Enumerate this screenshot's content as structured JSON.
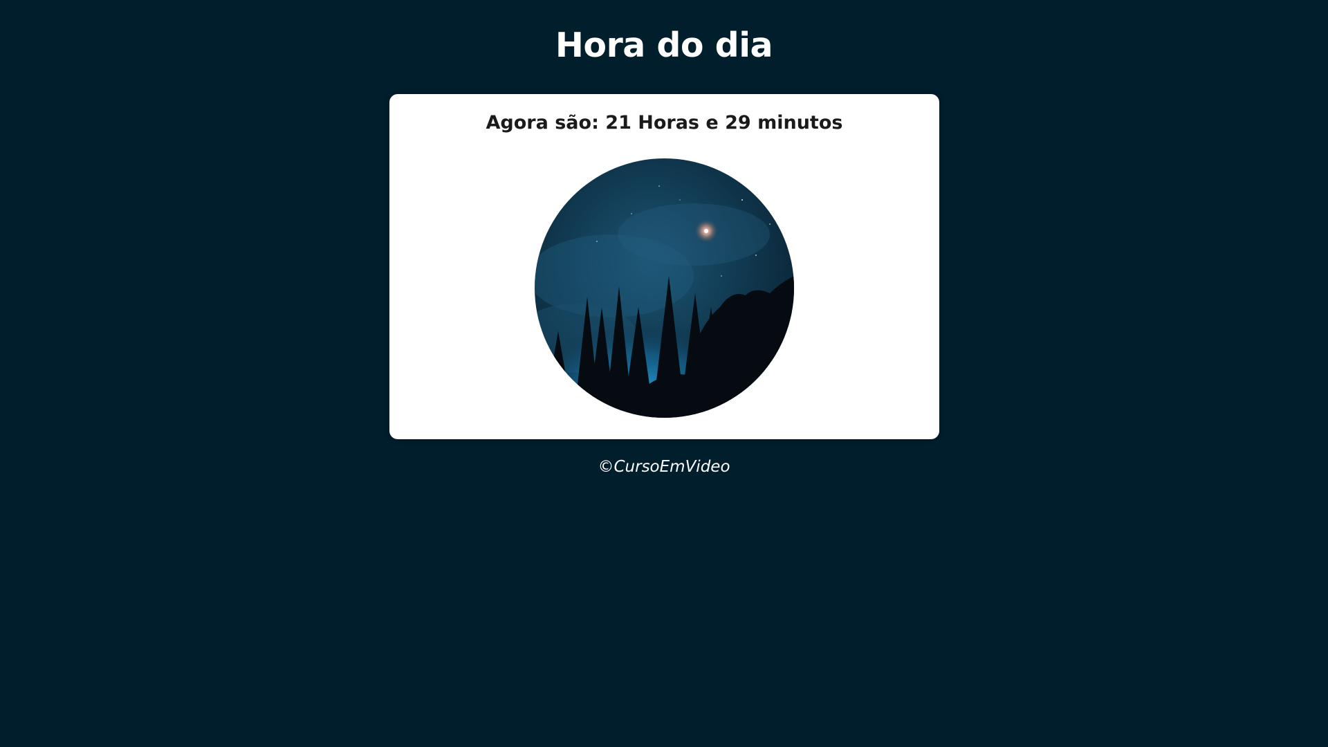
{
  "page": {
    "title": "Hora do dia",
    "background_color": "#011e2c"
  },
  "card": {
    "time_message": "Agora são: 21 Horas e 29 minutos",
    "image": {
      "icon": "night-forest-image",
      "period": "night"
    }
  },
  "footer": {
    "text": "©CursoEmVideo"
  }
}
